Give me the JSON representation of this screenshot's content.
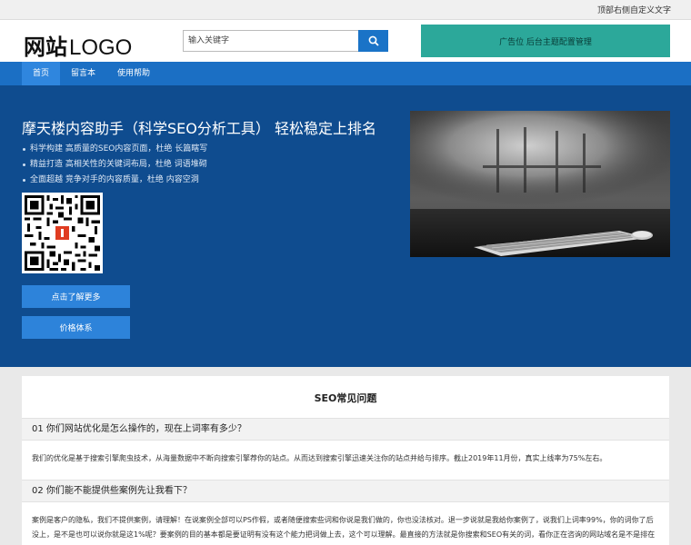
{
  "topbar": {
    "right_text": "顶部右侧自定义文字"
  },
  "header": {
    "logo_cn": "网站",
    "logo_en": "LOGO",
    "search_placeholder": "输入关键字",
    "ad_text": "广告位 后台主题配置管理"
  },
  "nav": {
    "items": [
      {
        "label": "首页"
      },
      {
        "label": "留言本"
      },
      {
        "label": "使用帮助"
      }
    ]
  },
  "hero": {
    "title": "摩天楼内容助手（科学SEO分析工具） 轻松稳定上排名",
    "bullets": [
      {
        "text": "科学构建 高质量的SEO内容页面，杜绝 长篇瞎写"
      },
      {
        "text": "精益打造 高相关性的关键词布局，杜绝 词语堆砌"
      },
      {
        "text": "全面超越 竞争对手的内容质量，杜绝 内容空洞"
      }
    ],
    "button_more": "点击了解更多",
    "button_price": "价格体系"
  },
  "faq": {
    "title": "SEO常见问题",
    "items": [
      {
        "question": "01 你们网站优化是怎么操作的，现在上词率有多少？",
        "answer": "我们的优化是基于搜索引擎爬虫技术，从海量数据中不断向搜索引擎荐你的站点。从而达到搜索引擎迅速关注你的站点并给与排序。截止2019年11月份，真实上线率为75%左右。"
      },
      {
        "question": "02 你们能不能提供些案例先让我看下？",
        "answer": "案例是客户的隐私，我们不提供案例，请理解！在说案例全部可以PS作假，或者随便搜索些词和你说是我们做的，你也没法核对。退一步说就是我给你案例了，说我们上词率99%，你的词你了后没上，是不是也可以说你就是这1%呢？要案例的目的基本都是要证明有没有这个能力把词做上去，这个可以理解。最直接的方法就是你搜索和SEO有关的词，看你正在咨询的网站域名是不是排在前列，如果自己做SEO的词自己的词都做不上去那就没法说了。如果词基本都在，你也不需要太担心了，因为这些词基本是全网几十万做SEO的竞争词，可以体现我们的技术能力。"
      }
    ]
  },
  "colors": {
    "nav_blue": "#1b6fc4",
    "hero_blue": "#0f4c8f",
    "ad_teal": "#2ca89a",
    "button_blue": "#2d83da"
  }
}
